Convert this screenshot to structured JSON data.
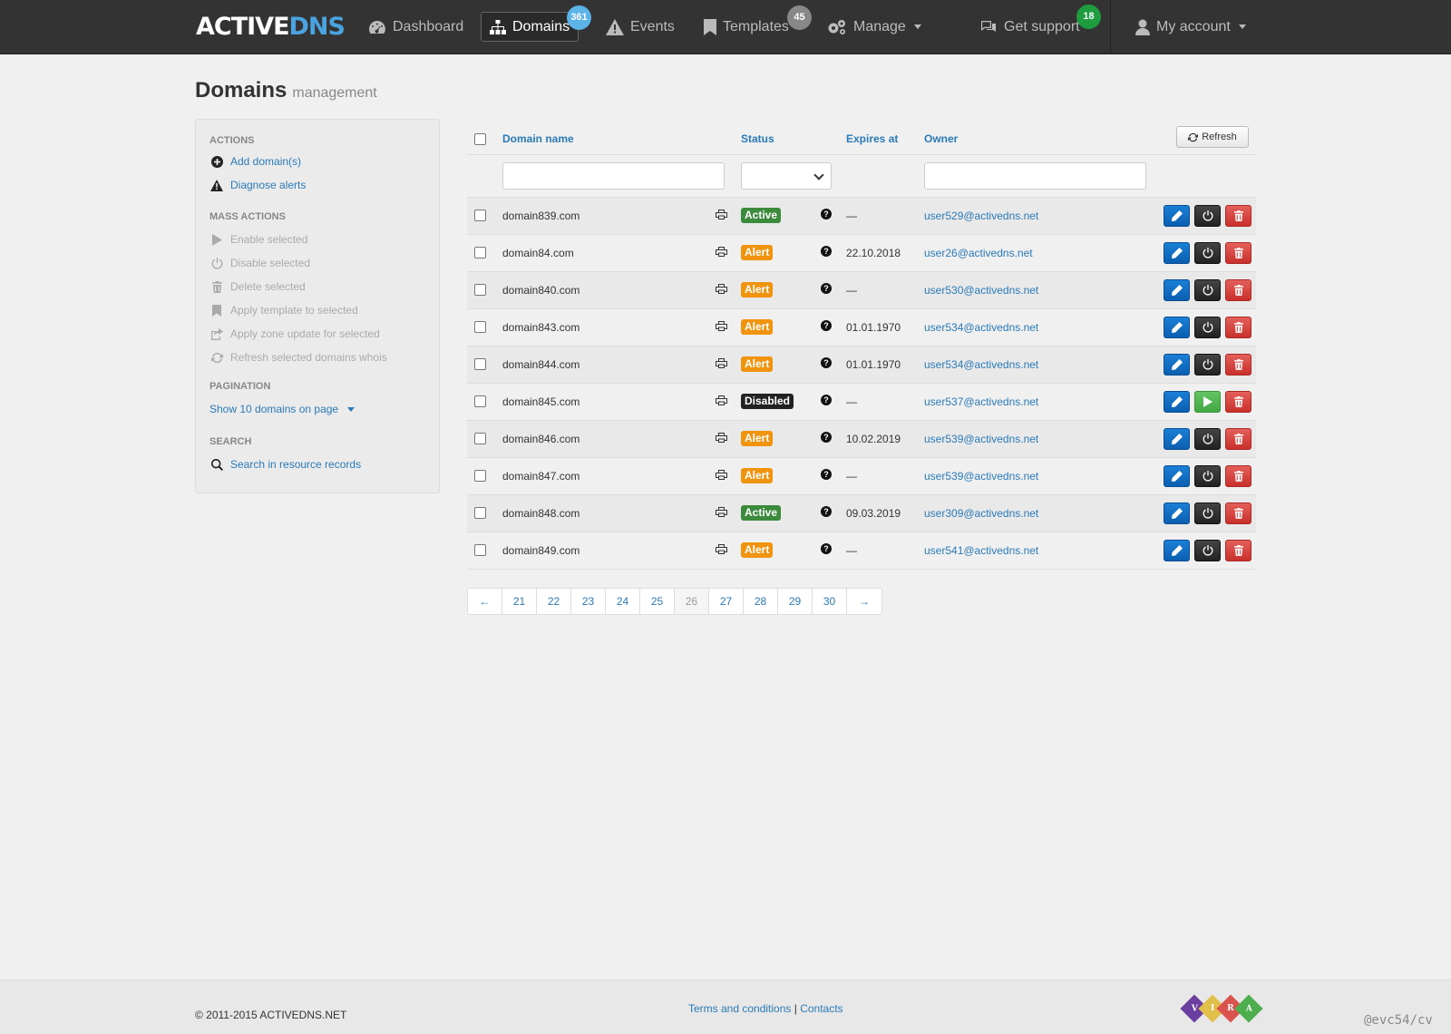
{
  "nav": {
    "logo_active": "ACTIVE",
    "logo_dns": "DNS",
    "dashboard": "Dashboard",
    "domains": "Domains",
    "domains_badge": "361",
    "events": "Events",
    "templates": "Templates",
    "templates_badge": "45",
    "manage": "Manage",
    "support": "Get support",
    "support_badge": "18",
    "account": "My account"
  },
  "page": {
    "title": "Domains",
    "subtitle": "management"
  },
  "sidebar": {
    "actions_heading": "Actions",
    "add_domains": "Add domain(s)",
    "diagnose_alerts": "Diagnose alerts",
    "mass_heading": "Mass actions",
    "enable_selected": "Enable selected",
    "disable_selected": "Disable selected",
    "delete_selected": "Delete selected",
    "apply_template": "Apply template to selected",
    "apply_zone": "Apply zone update for selected",
    "refresh_whois": "Refresh selected domains whois",
    "pagination_heading": "Pagination",
    "show_per_page": "Show 10 domains on page",
    "search_heading": "Search",
    "search_records": "Search in resource records"
  },
  "table": {
    "col_domain": "Domain name",
    "col_status": "Status",
    "col_expires": "Expires at",
    "col_owner": "Owner",
    "refresh": "Refresh",
    "rows": [
      {
        "domain": "domain839.com",
        "status": "Active",
        "expires": "—",
        "owner": "user529@activedns.net",
        "enabled": true
      },
      {
        "domain": "domain84.com",
        "status": "Alert",
        "expires": "22.10.2018",
        "owner": "user26@activedns.net",
        "enabled": true
      },
      {
        "domain": "domain840.com",
        "status": "Alert",
        "expires": "—",
        "owner": "user530@activedns.net",
        "enabled": true
      },
      {
        "domain": "domain843.com",
        "status": "Alert",
        "expires": "01.01.1970",
        "owner": "user534@activedns.net",
        "enabled": true
      },
      {
        "domain": "domain844.com",
        "status": "Alert",
        "expires": "01.01.1970",
        "owner": "user534@activedns.net",
        "enabled": true
      },
      {
        "domain": "domain845.com",
        "status": "Disabled",
        "expires": "—",
        "owner": "user537@activedns.net",
        "enabled": false
      },
      {
        "domain": "domain846.com",
        "status": "Alert",
        "expires": "10.02.2019",
        "owner": "user539@activedns.net",
        "enabled": true
      },
      {
        "domain": "domain847.com",
        "status": "Alert",
        "expires": "—",
        "owner": "user539@activedns.net",
        "enabled": true
      },
      {
        "domain": "domain848.com",
        "status": "Active",
        "expires": "09.03.2019",
        "owner": "user309@activedns.net",
        "enabled": true
      },
      {
        "domain": "domain849.com",
        "status": "Alert",
        "expires": "—",
        "owner": "user541@activedns.net",
        "enabled": true
      }
    ]
  },
  "status_colors": {
    "Active": "#3c8a3c",
    "Alert": "#f0930e",
    "Disabled": "#222222"
  },
  "pagination": {
    "prev": "←",
    "next": "→",
    "pages": [
      "21",
      "22",
      "23",
      "24",
      "25",
      "26",
      "27",
      "28",
      "29",
      "30"
    ],
    "current": "26"
  },
  "footer": {
    "copyright": "© 2011-2015 ACTIVEDNS.NET",
    "terms": "Terms and conditions",
    "separator": "|",
    "contacts": "Contacts",
    "vira": [
      "V",
      "I",
      "R",
      "A"
    ],
    "watermark": "@evc54/cv"
  }
}
